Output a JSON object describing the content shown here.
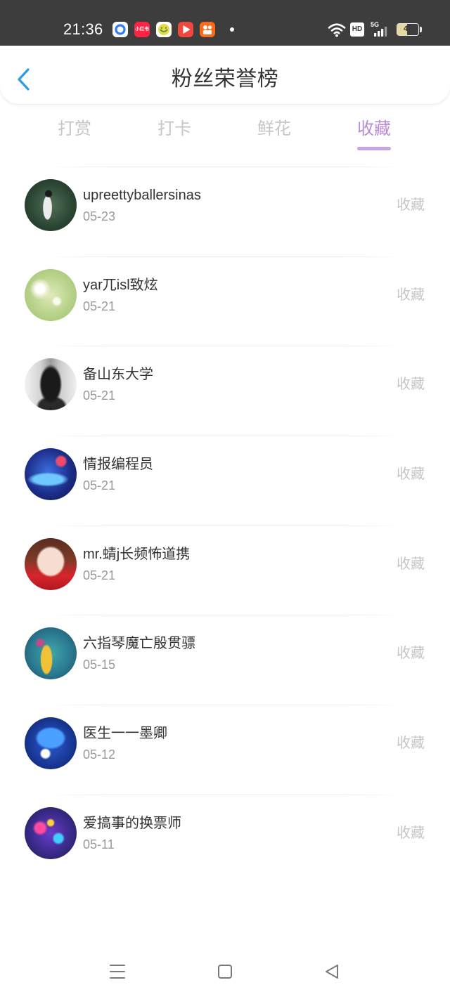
{
  "theme": {
    "status_bar_bg": "#3d3d3d",
    "accent": "#b98ad8",
    "accent_underline": "#c9a2e5",
    "back_arrow": "#2b9ae8",
    "text_primary": "#333333",
    "text_secondary": "#9a9a9a",
    "text_muted": "#c6c6c6"
  },
  "status_bar": {
    "time": "21:36",
    "notification_icons": [
      {
        "icon": "browser-app-icon",
        "color": "#2f7cf6"
      },
      {
        "icon": "xiaohongshu-app-icon",
        "color": "#ff2442",
        "logo_text": "小红书"
      },
      {
        "icon": "chat-app-icon",
        "color": "#e9d84a"
      },
      {
        "icon": "video-app-icon",
        "color": "#f0473f"
      },
      {
        "icon": "kuaishou-app-icon",
        "color": "#ff6a1a"
      }
    ],
    "more_indicator_icon": "dot-icon",
    "wifi_icon": "wifi-icon",
    "hd_badge": "HD",
    "network_type": "5G",
    "signal_icon": "signal-bars-icon",
    "battery_level": "47"
  },
  "header": {
    "back_icon": "chevron-left-icon",
    "title": "粉丝荣誉榜"
  },
  "tabs": [
    {
      "label": "打赏",
      "active": false
    },
    {
      "label": "打卡",
      "active": false
    },
    {
      "label": "鲜花",
      "active": false
    },
    {
      "label": "收藏",
      "active": true
    }
  ],
  "fans": [
    {
      "name": "upreettyballersinas",
      "date": "05-23",
      "action": "收藏"
    },
    {
      "name": "yar兀isl致炫",
      "date": "05-21",
      "action": "收藏"
    },
    {
      "name": "备山东大学",
      "date": "05-21",
      "action": "收藏"
    },
    {
      "name": "情报编程员",
      "date": "05-21",
      "action": "收藏"
    },
    {
      "name": "mr.蜻j长频怖道携",
      "date": "05-21",
      "action": "收藏"
    },
    {
      "name": "六指琴魔亡殷贯骠",
      "date": "05-15",
      "action": "收藏"
    },
    {
      "name": "医生一一墨卿",
      "date": "05-12",
      "action": "收藏"
    },
    {
      "name": "爱搞事的换票师",
      "date": "05-11",
      "action": "收藏"
    }
  ],
  "nav_bar": {
    "menu_icon": "menu-icon",
    "home_icon": "home-square-icon",
    "back_icon": "back-triangle-icon"
  }
}
